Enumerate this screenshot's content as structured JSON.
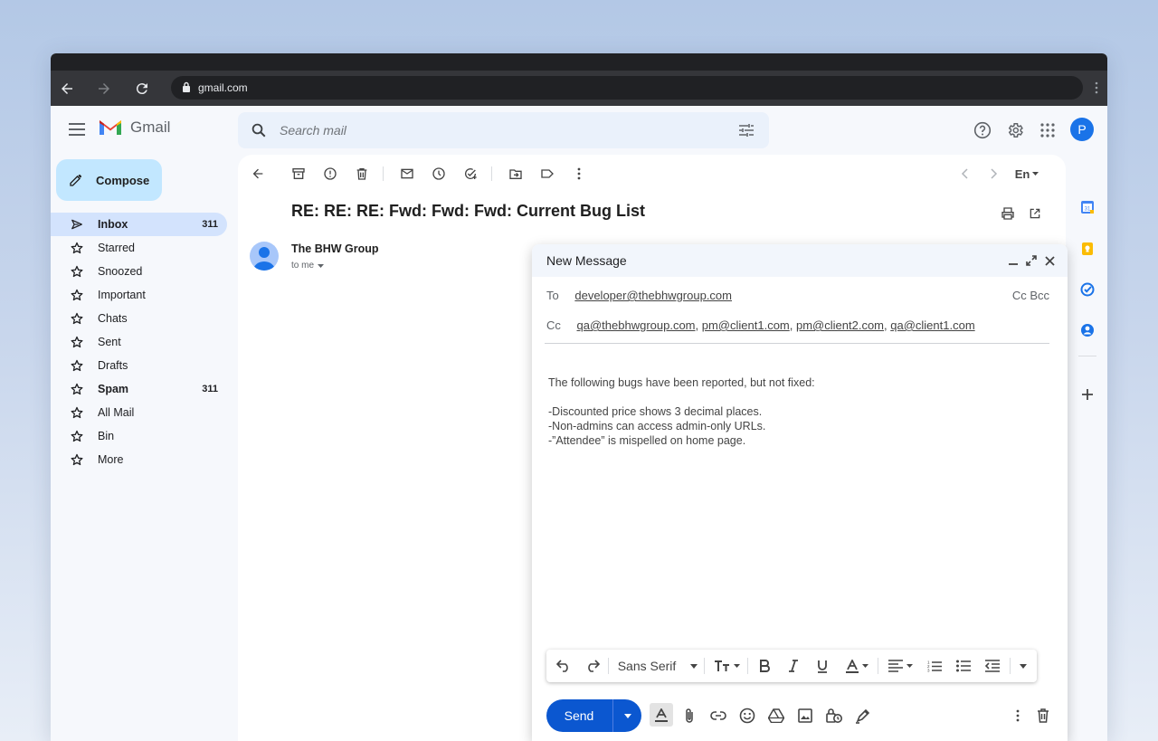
{
  "browser": {
    "url": "gmail.com"
  },
  "gmail": {
    "brand": "Gmail",
    "search_placeholder": "Search mail",
    "avatar_initial": "P",
    "compose_label": "Compose"
  },
  "nav": [
    {
      "label": "Inbox",
      "count": "311",
      "bold": true,
      "active": true,
      "icon": "inbox-icon"
    },
    {
      "label": "Starred",
      "count": "",
      "icon": "star-icon"
    },
    {
      "label": "Snoozed",
      "count": "",
      "icon": "star-icon"
    },
    {
      "label": "Important",
      "count": "",
      "icon": "star-icon"
    },
    {
      "label": "Chats",
      "count": "",
      "icon": "star-icon"
    },
    {
      "label": "Sent",
      "count": "",
      "icon": "star-icon"
    },
    {
      "label": "Drafts",
      "count": "",
      "icon": "star-icon"
    },
    {
      "label": "Spam",
      "count": "311",
      "bold": true,
      "icon": "star-icon"
    },
    {
      "label": "All Mail",
      "count": "",
      "icon": "star-icon"
    },
    {
      "label": "Bin",
      "count": "",
      "icon": "star-icon"
    },
    {
      "label": "More",
      "count": "",
      "icon": "star-icon"
    }
  ],
  "thread": {
    "subject": "RE: RE: RE: Fwd: Fwd: Fwd: Current Bug List",
    "sender": "The BHW Group",
    "to_line": "to me",
    "lang_label": "En"
  },
  "compose": {
    "title": "New Message",
    "to_label": "To",
    "to": "developer@thebhwgroup.com",
    "cc_bcc": "Cc Bcc",
    "cc_label": "Cc",
    "cc": [
      "qa@thebhwgroup.com",
      "pm@client1.com",
      "pm@client2.com",
      "qa@client1.com"
    ],
    "body": {
      "line1": "The following bugs have been reported, but not fixed:",
      "bullets": [
        "-Discounted price shows 3 decimal places.",
        "-Non-admins can access admin-only URLs.",
        "-”Attendee” is mispelled on home page."
      ]
    },
    "font_name": "Sans Serif",
    "send_label": "Send"
  },
  "colors": {
    "accent": "#0b57d0",
    "compose_bg": "#c2e7ff",
    "active_nav": "#d3e3fd"
  }
}
